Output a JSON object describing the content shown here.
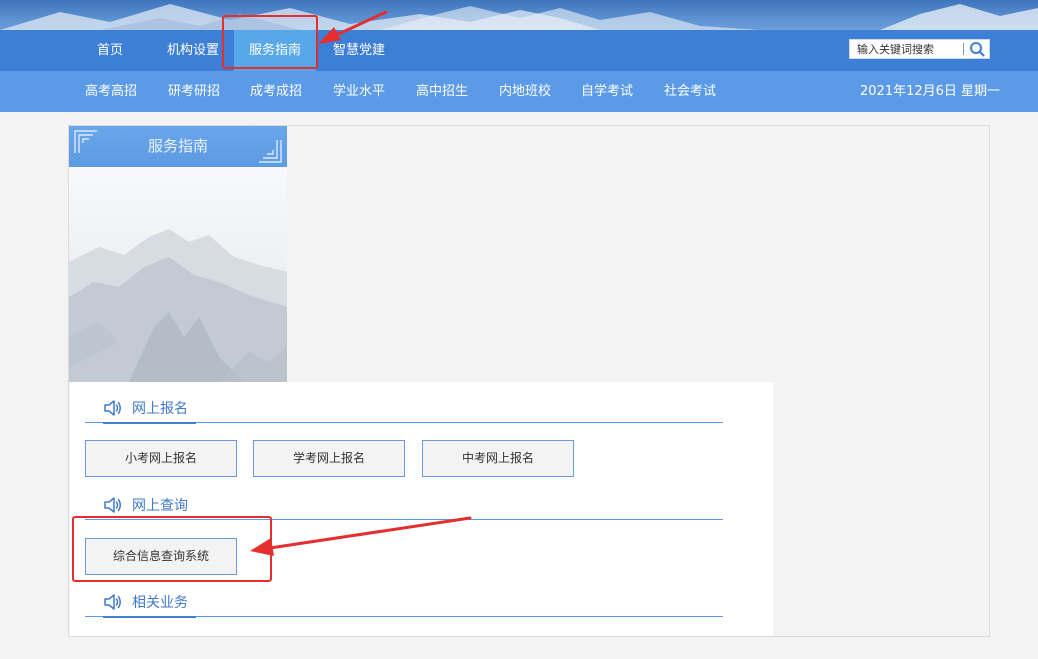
{
  "nav_primary": [
    {
      "label": "首页"
    },
    {
      "label": "机构设置"
    },
    {
      "label": "服务指南",
      "active": true
    },
    {
      "label": "智慧党建"
    }
  ],
  "search": {
    "placeholder": "输入关键词搜索",
    "icon": "search-icon"
  },
  "nav_secondary": [
    {
      "label": "高考高招"
    },
    {
      "label": "研考研招"
    },
    {
      "label": "成考成招"
    },
    {
      "label": "学业水平"
    },
    {
      "label": "高中招生"
    },
    {
      "label": "内地班校"
    },
    {
      "label": "自学考试"
    },
    {
      "label": "社会考试"
    }
  ],
  "date_text": "2021年12月6日 星期一",
  "sidebar": {
    "title": "服务指南"
  },
  "sections": [
    {
      "title": "网上报名",
      "icon": "speaker-icon",
      "buttons": [
        {
          "label": "小考网上报名"
        },
        {
          "label": "学考网上报名"
        },
        {
          "label": "中考网上报名"
        }
      ]
    },
    {
      "title": "网上查询",
      "icon": "speaker-icon",
      "buttons": [
        {
          "label": "综合信息查询系统"
        }
      ]
    },
    {
      "title": "相关业务",
      "icon": "speaker-icon",
      "buttons": []
    }
  ],
  "colors": {
    "nav_primary_bg": "#3d7fd5",
    "nav_active_bg": "#58a7e8",
    "nav_secondary_bg": "#5b9ae6",
    "section_title": "#3f79c8",
    "annotation": "#e52e2e"
  }
}
